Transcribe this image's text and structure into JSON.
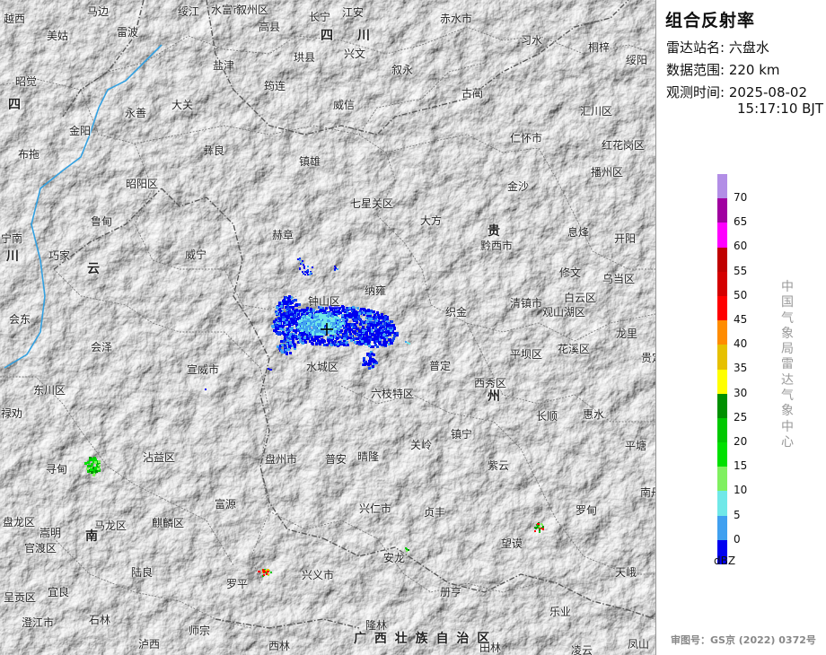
{
  "panel": {
    "title": "组合反射率",
    "station_key": "雷达站名:",
    "station_value": "六盘水",
    "range_key": "数据范围:",
    "range_value": "220 km",
    "time_key": "观测时间:",
    "time_date": "2025-08-02",
    "time_clock": "15:17:10 BJT",
    "unit": "dBZ",
    "vertical_label": "中国气象局雷达气象中心",
    "approval": "审图号：GS京 (2022) 0372号"
  },
  "legend": {
    "colors": [
      "#b28ee6",
      "#a000a0",
      "#ff00ff",
      "#c00000",
      "#d40000",
      "#ff0000",
      "#ff8c00",
      "#e6c000",
      "#ffff00",
      "#009000",
      "#00c800",
      "#00e000",
      "#80f060",
      "#70e8e8",
      "#40a0f0",
      "#0000f0"
    ],
    "labels": [
      "70",
      "65",
      "60",
      "55",
      "50",
      "45",
      "40",
      "35",
      "30",
      "25",
      "20",
      "15",
      "10",
      "5",
      "0"
    ]
  },
  "places": [
    {
      "name": "越西",
      "pos": [
        4,
        12
      ]
    },
    {
      "name": "马边",
      "pos": [
        97,
        4
      ]
    },
    {
      "name": "绥江",
      "pos": [
        198,
        4
      ]
    },
    {
      "name": "水富市",
      "pos": [
        235,
        2
      ]
    },
    {
      "name": "叙州区",
      "pos": [
        263,
        2
      ]
    },
    {
      "name": "高县",
      "pos": [
        288,
        21
      ]
    },
    {
      "name": "长宁",
      "pos": [
        344,
        10
      ]
    },
    {
      "name": "江安",
      "pos": [
        381,
        5
      ]
    },
    {
      "name": "赤水市",
      "pos": [
        490,
        12
      ]
    },
    {
      "name": "美姑",
      "pos": [
        52,
        31
      ]
    },
    {
      "name": "雷波",
      "pos": [
        130,
        27
      ]
    },
    {
      "name": "珙县",
      "pos": [
        327,
        55
      ]
    },
    {
      "name": "兴文",
      "pos": [
        383,
        51
      ]
    },
    {
      "name": "习水",
      "pos": [
        580,
        36
      ]
    },
    {
      "name": "桐梓",
      "pos": [
        655,
        44
      ]
    },
    {
      "name": "绥阳",
      "pos": [
        697,
        58
      ]
    },
    {
      "name": "盐津",
      "pos": [
        237,
        64
      ]
    },
    {
      "name": "叙永",
      "pos": [
        436,
        69
      ]
    },
    {
      "name": "昭觉",
      "pos": [
        17,
        82
      ]
    },
    {
      "name": "筠连",
      "pos": [
        294,
        87
      ]
    },
    {
      "name": "古蔺",
      "pos": [
        514,
        95
      ]
    },
    {
      "name": "永善",
      "pos": [
        139,
        117
      ]
    },
    {
      "name": "大关",
      "pos": [
        191,
        108
      ]
    },
    {
      "name": "威信",
      "pos": [
        371,
        108
      ]
    },
    {
      "name": "汇川区",
      "pos": [
        646,
        115
      ]
    },
    {
      "name": "金阳",
      "pos": [
        77,
        137
      ]
    },
    {
      "name": "仁怀市",
      "pos": [
        568,
        145
      ]
    },
    {
      "name": "红花岗区",
      "pos": [
        670,
        153
      ]
    },
    {
      "name": "布拖",
      "pos": [
        20,
        163
      ]
    },
    {
      "name": "彝良",
      "pos": [
        226,
        159
      ]
    },
    {
      "name": "镇雄",
      "pos": [
        333,
        171
      ]
    },
    {
      "name": "播州区",
      "pos": [
        658,
        183
      ]
    },
    {
      "name": "昭阳区",
      "pos": [
        140,
        196
      ]
    },
    {
      "name": "金沙",
      "pos": [
        565,
        199
      ]
    },
    {
      "name": "七星关区",
      "pos": [
        390,
        218
      ]
    },
    {
      "name": "鲁甸",
      "pos": [
        101,
        238
      ]
    },
    {
      "name": "大方",
      "pos": [
        468,
        237
      ]
    },
    {
      "name": "黔西市",
      "pos": [
        535,
        265
      ]
    },
    {
      "name": "息烽",
      "pos": [
        632,
        250
      ]
    },
    {
      "name": "开阳",
      "pos": [
        684,
        257
      ]
    },
    {
      "name": "宁南",
      "pos": [
        1,
        257
      ]
    },
    {
      "name": "赫章",
      "pos": [
        303,
        253
      ]
    },
    {
      "name": "巧家",
      "pos": [
        54,
        276
      ]
    },
    {
      "name": "威宁",
      "pos": [
        206,
        275
      ]
    },
    {
      "name": "修文",
      "pos": [
        623,
        295
      ]
    },
    {
      "name": "纳雍",
      "pos": [
        406,
        315
      ]
    },
    {
      "name": "钟山区",
      "pos": [
        343,
        327
      ]
    },
    {
      "name": "清镇市",
      "pos": [
        568,
        329
      ]
    },
    {
      "name": "白云区",
      "pos": [
        628,
        323
      ]
    },
    {
      "name": "观山湖区",
      "pos": [
        604,
        339
      ]
    },
    {
      "name": "织金",
      "pos": [
        496,
        339
      ]
    },
    {
      "name": "会东",
      "pos": [
        10,
        347
      ]
    },
    {
      "name": "龙里",
      "pos": [
        686,
        363
      ]
    },
    {
      "name": "会泽",
      "pos": [
        101,
        378
      ]
    },
    {
      "name": "平坝区",
      "pos": [
        568,
        386
      ]
    },
    {
      "name": "花溪区",
      "pos": [
        621,
        380
      ]
    },
    {
      "name": "水城区",
      "pos": [
        341,
        400
      ]
    },
    {
      "name": "普定",
      "pos": [
        478,
        399
      ]
    },
    {
      "name": "宣威市",
      "pos": [
        208,
        403
      ]
    },
    {
      "name": "西秀区",
      "pos": [
        528,
        418
      ]
    },
    {
      "name": "六枝特区",
      "pos": [
        413,
        430
      ]
    },
    {
      "name": "东川区",
      "pos": [
        37,
        426
      ]
    },
    {
      "name": "禄劝",
      "pos": [
        1,
        452
      ]
    },
    {
      "name": "长顺",
      "pos": [
        597,
        455
      ]
    },
    {
      "name": "惠水",
      "pos": [
        649,
        453
      ]
    },
    {
      "name": "镇宁",
      "pos": [
        502,
        475
      ]
    },
    {
      "name": "关岭",
      "pos": [
        457,
        487
      ]
    },
    {
      "name": "平塘",
      "pos": [
        696,
        488
      ]
    },
    {
      "name": "寻甸",
      "pos": [
        51,
        514
      ]
    },
    {
      "name": "沾益区",
      "pos": [
        159,
        501
      ]
    },
    {
      "name": "盘州市",
      "pos": [
        295,
        503
      ]
    },
    {
      "name": "普安",
      "pos": [
        362,
        503
      ]
    },
    {
      "name": "晴隆",
      "pos": [
        398,
        500
      ]
    },
    {
      "name": "紫云",
      "pos": [
        543,
        510
      ]
    },
    {
      "name": "富源",
      "pos": [
        239,
        553
      ]
    },
    {
      "name": "兴仁市",
      "pos": [
        400,
        558
      ]
    },
    {
      "name": "贞丰",
      "pos": [
        472,
        562
      ]
    },
    {
      "name": "罗甸",
      "pos": [
        641,
        560
      ]
    },
    {
      "name": "嵩明",
      "pos": [
        44,
        585
      ]
    },
    {
      "name": "马龙区",
      "pos": [
        105,
        577
      ]
    },
    {
      "name": "麒麟区",
      "pos": [
        169,
        574
      ]
    },
    {
      "name": "望谟",
      "pos": [
        558,
        597
      ]
    },
    {
      "name": "安龙",
      "pos": [
        427,
        613
      ]
    },
    {
      "name": "陆良",
      "pos": [
        146,
        629
      ]
    },
    {
      "name": "兴义市",
      "pos": [
        336,
        632
      ]
    },
    {
      "name": "天峨",
      "pos": [
        685,
        629
      ]
    },
    {
      "name": "罗平",
      "pos": [
        252,
        642
      ]
    },
    {
      "name": "宜良",
      "pos": [
        53,
        651
      ]
    },
    {
      "name": "册亨",
      "pos": [
        490,
        651
      ]
    },
    {
      "name": "呈贡区",
      "pos": [
        4,
        657
      ]
    },
    {
      "name": "乐业",
      "pos": [
        612,
        673
      ]
    },
    {
      "name": "石林",
      "pos": [
        99,
        682
      ]
    },
    {
      "name": "师宗",
      "pos": [
        210,
        694
      ]
    },
    {
      "name": "隆林",
      "pos": [
        407,
        688
      ]
    },
    {
      "name": "泸西",
      "pos": [
        154,
        709
      ]
    },
    {
      "name": "西林",
      "pos": [
        299,
        711
      ]
    },
    {
      "name": "田林",
      "pos": [
        534,
        713
      ]
    },
    {
      "name": "凤山",
      "pos": [
        699,
        709
      ]
    },
    {
      "name": "凌云",
      "pos": [
        636,
        716
      ]
    },
    {
      "name": "澄江市",
      "pos": [
        24,
        685
      ]
    },
    {
      "name": "盘龙区",
      "pos": [
        3,
        573
      ]
    },
    {
      "name": "官渡区",
      "pos": [
        27,
        602
      ]
    },
    {
      "name": "南丹",
      "pos": [
        713,
        540
      ]
    },
    {
      "name": "乌当区",
      "pos": [
        671,
        302
      ]
    },
    {
      "name": "贵定",
      "pos": [
        714,
        390
      ]
    }
  ],
  "regions": [
    {
      "name": "四",
      "pos": [
        357,
        29
      ]
    },
    {
      "name": "川",
      "pos": [
        398,
        29
      ]
    },
    {
      "name": "四",
      "pos": [
        9,
        106
      ]
    },
    {
      "name": "川",
      "pos": [
        7,
        275
      ]
    },
    {
      "name": "云",
      "pos": [
        97,
        289
      ]
    },
    {
      "name": "贵",
      "pos": [
        543,
        247
      ]
    },
    {
      "name": "州",
      "pos": [
        543,
        431
      ]
    },
    {
      "name": "南",
      "pos": [
        95,
        587
      ]
    },
    {
      "name": "广 西 壮 族 自 治 区",
      "pos": [
        394,
        701
      ]
    }
  ]
}
